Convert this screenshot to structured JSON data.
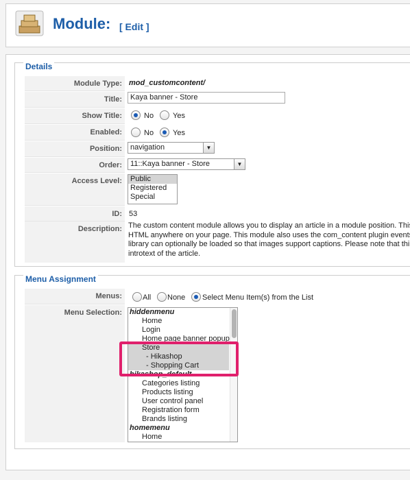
{
  "header": {
    "title": "Module:",
    "edit_label": "[ Edit ]"
  },
  "details": {
    "legend": "Details",
    "module_type": {
      "label": "Module Type:",
      "value": "mod_customcontent/"
    },
    "title_field": {
      "label": "Title:",
      "value": "Kaya banner - Store"
    },
    "show_title": {
      "label": "Show Title:",
      "no": "No",
      "yes": "Yes",
      "selected": "No"
    },
    "enabled": {
      "label": "Enabled:",
      "no": "No",
      "yes": "Yes",
      "selected": "Yes"
    },
    "position": {
      "label": "Position:",
      "value": "navigation"
    },
    "order": {
      "label": "Order:",
      "value": "11::Kaya banner - Store"
    },
    "access_level": {
      "label": "Access Level:",
      "options": [
        "Public",
        "Registered",
        "Special"
      ],
      "selected": "Public"
    },
    "id": {
      "label": "ID:",
      "value": "53"
    },
    "description": {
      "label": "Description:",
      "lines": [
        "The custom content module allows you to display an article in a module position. This",
        "HTML anywhere on your page. This module also uses the com_content plugin events",
        "library can optionally be loaded so that images support captions. Please note that thi",
        "introtext of the article."
      ]
    }
  },
  "menu_assignment": {
    "legend": "Menu Assignment",
    "menus": {
      "label": "Menus:",
      "all": "All",
      "none": "None",
      "select": "Select Menu Item(s) from the List",
      "selected": "select"
    },
    "menu_selection": {
      "label": "Menu Selection:",
      "items": [
        {
          "text": "hiddenmenu",
          "type": "group"
        },
        {
          "text": "Home",
          "type": "item"
        },
        {
          "text": "Login",
          "type": "item"
        },
        {
          "text": "Home page banner popup",
          "type": "item"
        },
        {
          "text": "Store",
          "type": "item",
          "selected": true
        },
        {
          "text": "- Hikashop",
          "type": "sub",
          "selected": true
        },
        {
          "text": "- Shopping Cart",
          "type": "sub",
          "selected": true
        },
        {
          "text": "hikashop_default",
          "type": "group"
        },
        {
          "text": "Categories listing",
          "type": "item"
        },
        {
          "text": "Products listing",
          "type": "item"
        },
        {
          "text": "User control panel",
          "type": "item"
        },
        {
          "text": "Registration form",
          "type": "item"
        },
        {
          "text": "Brands listing",
          "type": "item"
        },
        {
          "text": "homemenu",
          "type": "group"
        },
        {
          "text": "Home",
          "type": "item"
        }
      ]
    }
  },
  "colors": {
    "title_blue": "#1d5ea8",
    "highlight": "#e0206c",
    "selection": "#d4d4d4"
  }
}
